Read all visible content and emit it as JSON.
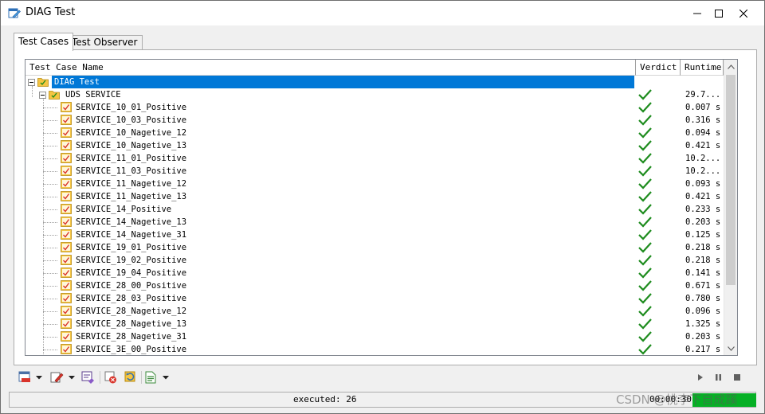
{
  "window": {
    "title": "DIAG Test",
    "app_icon": "diag-test-icon",
    "controls": {
      "minimize": "minimize-icon",
      "maximize": "maximize-icon",
      "close": "close-icon"
    }
  },
  "tabs": [
    {
      "label": "Test Cases",
      "active": true
    },
    {
      "label": "Test Observer",
      "active": false
    }
  ],
  "columns": {
    "name": "Test Case Name",
    "verdict": "Verdict",
    "runtime": "Runtime"
  },
  "tree": {
    "root": {
      "label": "DIAG Test",
      "selected": true
    },
    "group": {
      "label": "UDS SERVICE",
      "runtime": "29.7...",
      "verdict": "pass"
    },
    "cases": [
      {
        "name": "SERVICE_10_01_Positive",
        "verdict": "pass",
        "runtime": "0.007 s"
      },
      {
        "name": "SERVICE_10_03_Positive",
        "verdict": "pass",
        "runtime": "0.316 s"
      },
      {
        "name": "SERVICE_10_Nagetive_12",
        "verdict": "pass",
        "runtime": "0.094 s"
      },
      {
        "name": "SERVICE_10_Nagetive_13",
        "verdict": "pass",
        "runtime": "0.421 s"
      },
      {
        "name": "SERVICE_11_01_Positive",
        "verdict": "pass",
        "runtime": "10.2..."
      },
      {
        "name": "SERVICE_11_03_Positive",
        "verdict": "pass",
        "runtime": "10.2..."
      },
      {
        "name": "SERVICE_11_Nagetive_12",
        "verdict": "pass",
        "runtime": "0.093 s"
      },
      {
        "name": "SERVICE_11_Nagetive_13",
        "verdict": "pass",
        "runtime": "0.421 s"
      },
      {
        "name": "SERVICE_14_Positive",
        "verdict": "pass",
        "runtime": "0.233 s"
      },
      {
        "name": "SERVICE_14_Nagetive_13",
        "verdict": "pass",
        "runtime": "0.203 s"
      },
      {
        "name": "SERVICE_14_Nagetive_31",
        "verdict": "pass",
        "runtime": "0.125 s"
      },
      {
        "name": "SERVICE_19_01_Positive",
        "verdict": "pass",
        "runtime": "0.218 s"
      },
      {
        "name": "SERVICE_19_02_Positive",
        "verdict": "pass",
        "runtime": "0.218 s"
      },
      {
        "name": "SERVICE_19_04_Positive",
        "verdict": "pass",
        "runtime": "0.141 s"
      },
      {
        "name": "SERVICE_28_00_Positive",
        "verdict": "pass",
        "runtime": "0.671 s"
      },
      {
        "name": "SERVICE_28_03_Positive",
        "verdict": "pass",
        "runtime": "0.780 s"
      },
      {
        "name": "SERVICE_28_Nagetive_12",
        "verdict": "pass",
        "runtime": "0.096 s"
      },
      {
        "name": "SERVICE_28_Nagetive_13",
        "verdict": "pass",
        "runtime": "1.325 s"
      },
      {
        "name": "SERVICE_28_Nagetive_31",
        "verdict": "pass",
        "runtime": "0.203 s"
      },
      {
        "name": "SERVICE_3E_00_Positive",
        "verdict": "pass",
        "runtime": "0.217 s"
      }
    ]
  },
  "toolbar": {
    "left": [
      "report-icon",
      "dropdown-arrow-icon",
      "edit-icon",
      "dropdown-arrow-icon",
      "observer-icon",
      "stop-test-icon",
      "refresh-icon",
      "document-icon",
      "dropdown-arrow-icon"
    ],
    "right": [
      "play-icon",
      "pause-icon",
      "stop-icon"
    ]
  },
  "status": {
    "executed": "executed: 26",
    "elapsed": "00:00:30",
    "progress": 1.0
  },
  "watermark": "CSDN @桃李下自成蹊",
  "colors": {
    "selection": "#0078d7",
    "pass_check": "#1e8c1e",
    "progress": "#06b025",
    "folder": "#f5c542"
  }
}
